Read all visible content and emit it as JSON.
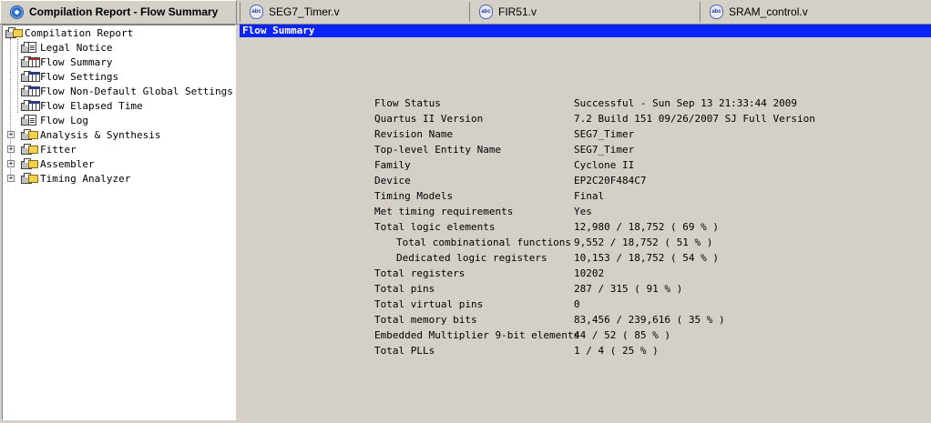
{
  "tabs": [
    {
      "label": "Compilation Report - Flow Summary",
      "icon": "compilation-report-icon",
      "active": true
    },
    {
      "label": "SEG7_Timer.v",
      "icon": "verilog-file-icon",
      "active": false
    },
    {
      "label": "FIR51.v",
      "icon": "verilog-file-icon",
      "active": false
    },
    {
      "label": "SRAM_control.v",
      "icon": "verilog-file-icon",
      "active": false
    }
  ],
  "tab_icon_text": "abc",
  "tree": {
    "root": "Compilation Report",
    "items": [
      {
        "label": "Legal Notice",
        "icon": "document-icon"
      },
      {
        "label": "Flow Summary",
        "icon": "table-icon",
        "selected": true
      },
      {
        "label": "Flow Settings",
        "icon": "table-icon"
      },
      {
        "label": "Flow Non-Default Global Settings",
        "icon": "table-icon"
      },
      {
        "label": "Flow Elapsed Time",
        "icon": "table-icon"
      },
      {
        "label": "Flow Log",
        "icon": "document-icon"
      },
      {
        "label": "Analysis & Synthesis",
        "icon": "folder-icon",
        "expandable": true
      },
      {
        "label": "Fitter",
        "icon": "folder-icon",
        "expandable": true
      },
      {
        "label": "Assembler",
        "icon": "folder-icon",
        "expandable": true
      },
      {
        "label": "Timing Analyzer",
        "icon": "folder-icon",
        "expandable": true
      }
    ]
  },
  "summary": {
    "title": "Flow Summary",
    "rows": [
      {
        "key": "Flow Status",
        "value": "Successful - Sun Sep 13 21:33:44 2009"
      },
      {
        "key": "Quartus II Version",
        "value": "7.2 Build 151 09/26/2007 SJ Full Version"
      },
      {
        "key": "Revision Name",
        "value": "SEG7_Timer"
      },
      {
        "key": "Top-level Entity Name",
        "value": "SEG7_Timer"
      },
      {
        "key": "Family",
        "value": "Cyclone II"
      },
      {
        "key": "Device",
        "value": "EP2C20F484C7"
      },
      {
        "key": "Timing Models",
        "value": "Final"
      },
      {
        "key": "Met timing requirements",
        "value": "Yes"
      },
      {
        "key": "Total logic elements",
        "value": "12,980 / 18,752 ( 69 % )"
      },
      {
        "key": "Total combinational functions",
        "value": "9,552 / 18,752 ( 51 % )",
        "indent": true
      },
      {
        "key": "Dedicated logic registers",
        "value": "10,153 / 18,752 ( 54 % )",
        "indent": true
      },
      {
        "key": "Total registers",
        "value": "10202"
      },
      {
        "key": "Total pins",
        "value": "287 / 315 ( 91 % )"
      },
      {
        "key": "Total virtual pins",
        "value": "0"
      },
      {
        "key": "Total memory bits",
        "value": "83,456 / 239,616 ( 35 % )"
      },
      {
        "key": "Embedded Multiplier 9-bit elements",
        "value": "44 / 52 ( 85 % )"
      },
      {
        "key": "Total PLLs",
        "value": "1 / 4 ( 25 % )"
      }
    ]
  },
  "colors": {
    "title_bar": "#0b24fb",
    "background": "#d4d0c8"
  }
}
